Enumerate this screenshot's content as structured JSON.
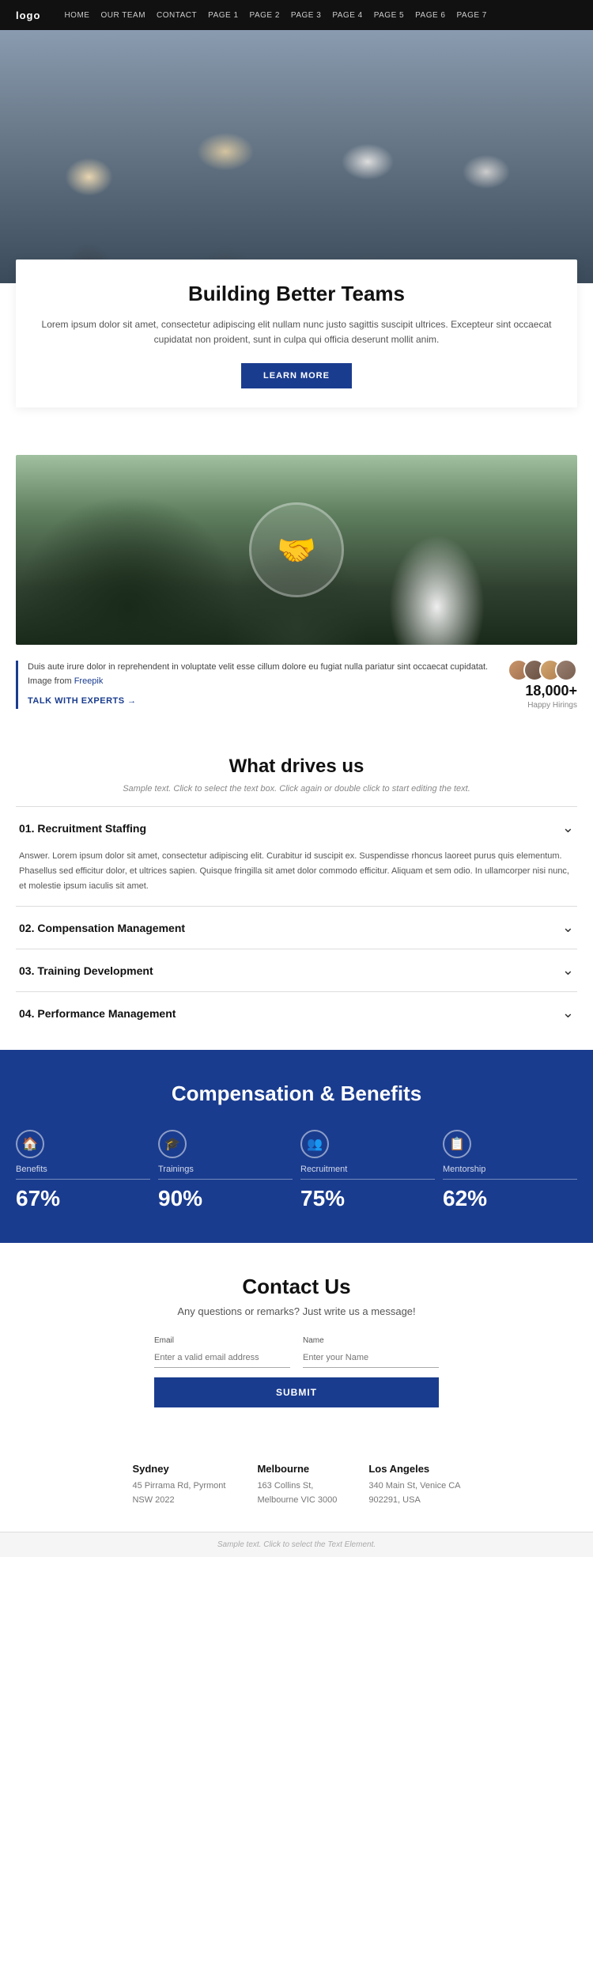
{
  "nav": {
    "logo": "logo",
    "links": [
      {
        "label": "HOME",
        "href": "#"
      },
      {
        "label": "OUR TEAM",
        "href": "#"
      },
      {
        "label": "CONTACT",
        "href": "#"
      },
      {
        "label": "PAGE 1",
        "href": "#"
      },
      {
        "label": "PAGE 2",
        "href": "#"
      },
      {
        "label": "PAGE 3",
        "href": "#"
      },
      {
        "label": "PAGE 4",
        "href": "#"
      },
      {
        "label": "PAGE 5",
        "href": "#"
      },
      {
        "label": "PAGE 6",
        "href": "#"
      },
      {
        "label": "PAGE 7",
        "href": "#"
      }
    ]
  },
  "hero": {
    "visible": true
  },
  "intro": {
    "title": "Building Better Teams",
    "body": "Lorem ipsum dolor sit amet, consectetur adipiscing elit nullam nunc justo sagittis suscipit ultrices. Excepteur sint occaecat cupidatat non proident, sunt in culpa qui officia deserunt mollit anim.",
    "button_label": "LEARN MORE"
  },
  "stats": {
    "body": "Duis aute irure dolor in reprehendent in voluptate velit esse cillum dolore eu fugiat nulla pariatur sint occaecat cupidatat. Image from ",
    "freepik_label": "Freepik",
    "talk_label": "TALK WITH EXPERTS  →",
    "count": "18,000+",
    "count_label": "Happy Hirings"
  },
  "what_drives": {
    "title": "What drives us",
    "subtitle": "Sample text. Click to select the text box. Click again or double click to start editing the text."
  },
  "accordion": [
    {
      "title": "01. Recruitment Staffing",
      "open": true,
      "content": "Answer. Lorem ipsum dolor sit amet, consectetur adipiscing elit. Curabitur id suscipit ex. Suspendisse rhoncus laoreet purus quis elementum. Phasellus sed efficitur dolor, et ultrices sapien. Quisque fringilla sit amet dolor commodo efficitur. Aliquam et sem odio. In ullamcorper nisi nunc, et molestie ipsum iaculis sit amet."
    },
    {
      "title": "02. Compensation Management",
      "open": false,
      "content": ""
    },
    {
      "title": "03. Training Development",
      "open": false,
      "content": ""
    },
    {
      "title": "04. Performance Management",
      "open": false,
      "content": ""
    }
  ],
  "comp_banner": {
    "title": "Compensation & Benefits",
    "items": [
      {
        "icon": "🏠",
        "label": "Benefits",
        "percent": "67%"
      },
      {
        "icon": "🎓",
        "label": "Trainings",
        "percent": "90%"
      },
      {
        "icon": "👥",
        "label": "Recruitment",
        "percent": "75%"
      },
      {
        "icon": "📋",
        "label": "Mentorship",
        "percent": "62%"
      }
    ]
  },
  "contact": {
    "title": "Contact Us",
    "subtitle": "Any questions or remarks? Just write us a message!",
    "email_label": "Email",
    "email_placeholder": "Enter a valid email address",
    "name_label": "Name",
    "name_placeholder": "Enter your Name",
    "submit_label": "SUBMIT",
    "offices": [
      {
        "city": "Sydney",
        "address": "45 Pirrama Rd, Pyrmont",
        "postcode": "NSW 2022"
      },
      {
        "city": "Melbourne",
        "address": "163 Collins St,",
        "postcode": "Melbourne VIC 3000"
      },
      {
        "city": "Los Angeles",
        "address": "340 Main St, Venice CA",
        "postcode": "902291, USA"
      }
    ]
  },
  "footer": {
    "text": "Sample text. Click to select the Text Element."
  }
}
